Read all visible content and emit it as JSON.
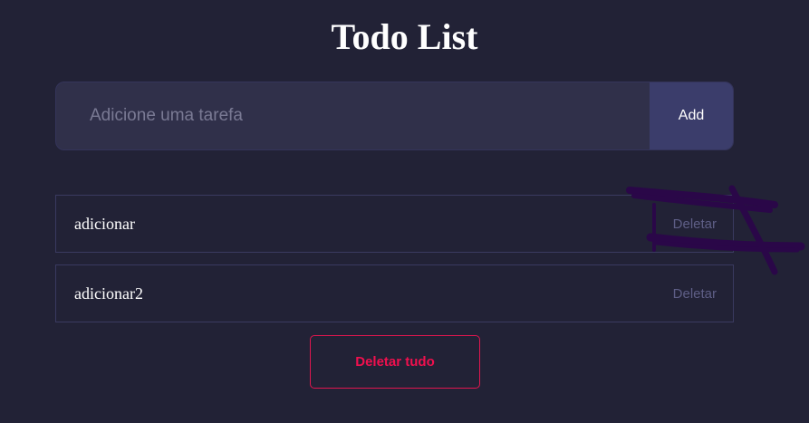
{
  "app": {
    "title": "Todo List"
  },
  "input": {
    "placeholder": "Adicione uma tarefa",
    "value": "",
    "add_label": "Add"
  },
  "todos": [
    {
      "text": "adicionar",
      "delete_label": "Deletar"
    },
    {
      "text": "adicionar2",
      "delete_label": "Deletar"
    }
  ],
  "actions": {
    "delete_all_label": "Deletar tudo"
  },
  "colors": {
    "background": "#222236",
    "input_bg": "#30304a",
    "add_button_bg": "#3b3d6b",
    "item_border": "#3a3a60",
    "delete_text": "#5e5e86",
    "delete_all_accent": "#f0104e",
    "scribble": "#2a0748"
  }
}
